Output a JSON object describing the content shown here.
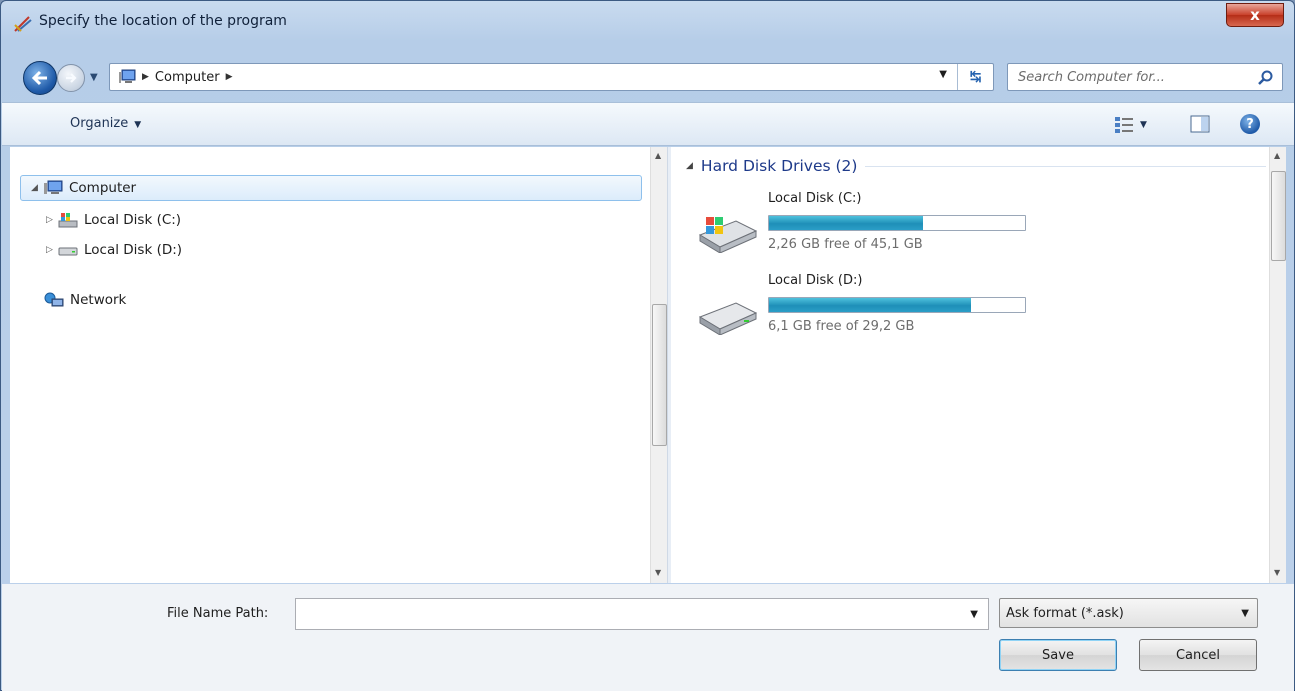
{
  "window": {
    "title": "Specify the location of the program",
    "close_label": "x"
  },
  "nav": {
    "address_crumb": "Computer",
    "search_placeholder": "Search Computer for..."
  },
  "toolbar": {
    "organize_label": "Organize"
  },
  "tree": {
    "items": [
      {
        "label": "Computer",
        "icon": "computer-icon"
      },
      {
        "label": "Local Disk (C:)",
        "icon": "system-drive-icon"
      },
      {
        "label": "Local Disk (D:)",
        "icon": "drive-icon"
      },
      {
        "label": "Network",
        "icon": "network-icon"
      }
    ]
  },
  "files": {
    "group_label": "Hard Disk Drives (2)",
    "drives": [
      {
        "name": "Local Disk (C:)",
        "free_text": "2,26 GB free of 45,1 GB",
        "used_fraction": 0.6
      },
      {
        "name": "Local Disk (D:)",
        "free_text": "6,1 GB free of 29,2 GB",
        "used_fraction": 0.79
      }
    ]
  },
  "bottom": {
    "file_name_label": "File Name Path:",
    "file_name_value": "",
    "file_type_selected": "Ask format (*.ask)",
    "save_label": "Save",
    "cancel_label": "Cancel"
  },
  "colors": {
    "accent_blue": "#1e3a8a",
    "bar_fill": "#1f8fb8",
    "close_red": "#c9402a"
  }
}
